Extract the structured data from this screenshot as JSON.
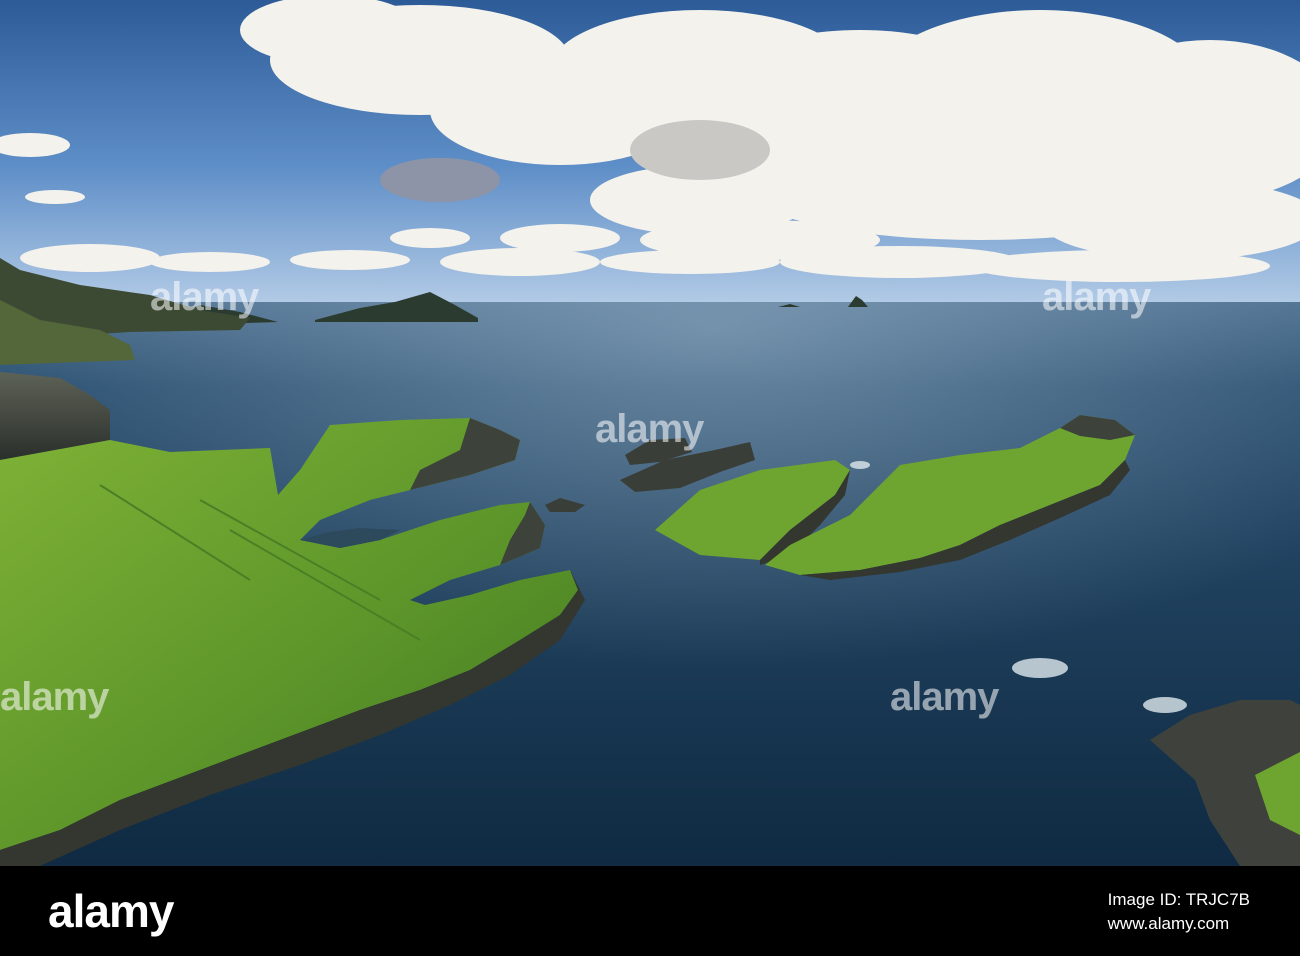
{
  "photo": {
    "subject": "aerial-coastline-photo",
    "watermark": "alamy",
    "colors": {
      "sky_top": "#2f5f9c",
      "sky_horizon": "#9fbde0",
      "sea_deep": "#112b45",
      "sea_mid": "#1f4766",
      "grass": "#5f9a2c",
      "grass_light": "#8fbf3c",
      "rock": "#3b3f3a",
      "cloud": "#f4f2ec"
    }
  },
  "footer": {
    "brand": "alamy",
    "image_id_label": "Image ID: TRJC7B",
    "website": "www.alamy.com",
    "background": "#000000"
  }
}
